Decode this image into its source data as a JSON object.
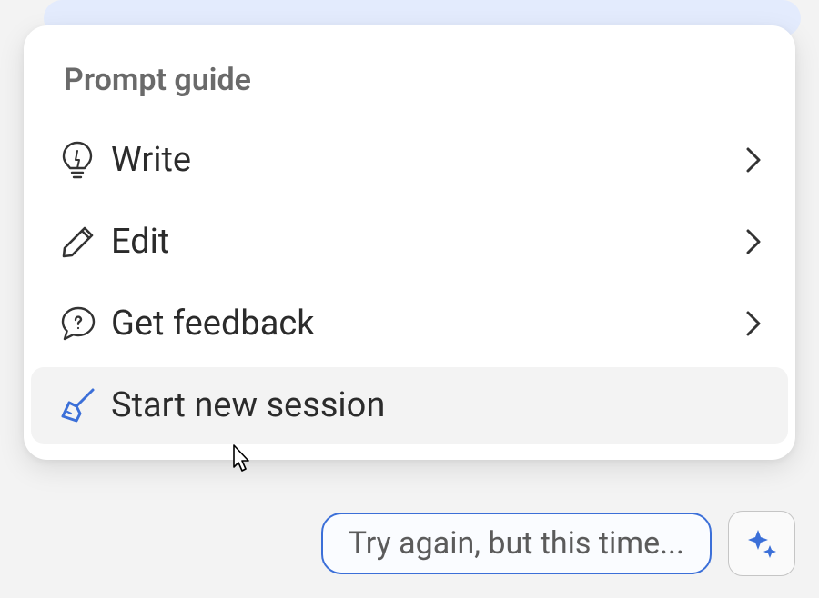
{
  "menu": {
    "title": "Prompt guide",
    "items": [
      {
        "icon": "lightbulb-icon",
        "label": "Write",
        "hasChevron": true,
        "hovered": false
      },
      {
        "icon": "pencil-icon",
        "label": "Edit",
        "hasChevron": true,
        "hovered": false
      },
      {
        "icon": "feedback-icon",
        "label": "Get feedback",
        "hasChevron": true,
        "hovered": false
      },
      {
        "icon": "broom-icon",
        "label": "Start new session",
        "hasChevron": false,
        "hovered": true
      }
    ]
  },
  "input": {
    "placeholder": "Try again, but this time..."
  },
  "colors": {
    "accent": "#3b6fd8",
    "iconStroke": "#333333",
    "broomStroke": "#3b6fd8"
  }
}
